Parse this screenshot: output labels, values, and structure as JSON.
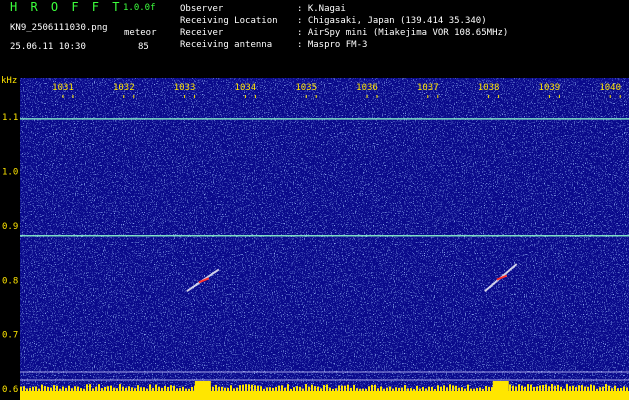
{
  "header": {
    "app_title": "H R O F F T",
    "version": "1.0.0f",
    "filename": "KN9_2506111030.png",
    "mode_label": "meteor",
    "datetime": "25.06.11 10:30",
    "count": "85",
    "info": [
      {
        "label": "Observer",
        "value": ": K.Nagai"
      },
      {
        "label": "Receiving Location",
        "value": ": Chigasaki, Japan (139.414 35.340)"
      },
      {
        "label": "Receiver",
        "value": ": AirSpy mini (Miakejima VOR 108.65MHz)"
      },
      {
        "label": "Receiving antenna",
        "value": ": Maspro FM-3"
      }
    ]
  },
  "colors": {
    "background": "#000000",
    "plot_bg": "#0a0a8c",
    "label_yellow": "#ffe600",
    "title_green": "#3cff3c",
    "trace": "#8fffd0"
  },
  "chart_data": {
    "type": "heatmap",
    "y_unit_label": "kHz",
    "x_ticks": [
      "1031",
      "1032",
      "1033",
      "1034",
      "1035",
      "1036",
      "1037",
      "1038",
      "1039",
      "1040"
    ],
    "y_ticks": [
      "1.1",
      "1.0",
      "0.9",
      "0.8",
      "0.7",
      "0.6"
    ],
    "y_range": [
      0.58,
      1.15
    ],
    "horizontal_traces_khz": [
      1.097,
      0.882
    ],
    "meteor_echoes": [
      {
        "x_minute": 1033.3,
        "y_from": 0.78,
        "y_to": 0.82
      },
      {
        "x_minute": 1038.2,
        "y_from": 0.78,
        "y_to": 0.83
      }
    ]
  }
}
